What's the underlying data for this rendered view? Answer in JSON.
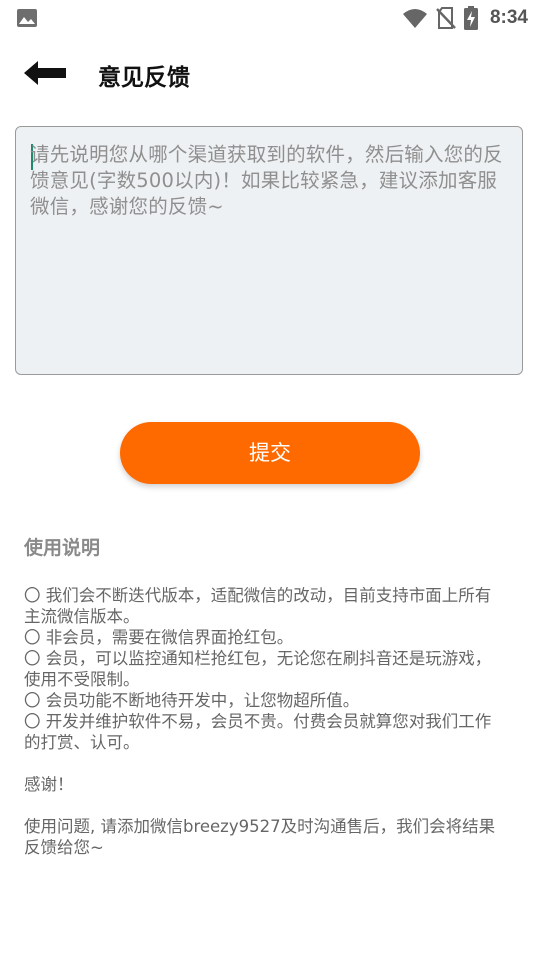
{
  "status_bar": {
    "time": "8:34",
    "icons": [
      "image-icon",
      "wifi-icon",
      "no-sim-icon",
      "battery-charging-icon"
    ]
  },
  "header": {
    "back_icon": "back-arrow-icon",
    "title": "意见反馈"
  },
  "feedback": {
    "placeholder": "请先说明您从哪个渠道获取到的软件，然后输入您的反馈意见(字数500以内)！如果比较紧急，建议添加客服微信，感谢您的反馈~",
    "value": ""
  },
  "submit_label": "提交",
  "instructions": {
    "title": "使用说明",
    "items": [
      "〇 我们会不断迭代版本，适配微信的改动，目前支持市面上所有主流微信版本。",
      " 〇 非会员，需要在微信界面抢红包。",
      " 〇 会员，可以监控通知栏抢红包，无论您在刷抖音还是玩游戏，使用不受限制。",
      " 〇 会员功能不断地待开发中，让您物超所值。",
      " 〇 开发并维护软件不易，会员不贵。付费会员就算您对我们工作的打赏、认可。"
    ],
    "thanks": " 感谢！",
    "contact": " 使用问题, 请添加微信breezy9527及时沟通售后，我们会将结果反馈给您~"
  },
  "colors": {
    "accent": "#ff6a00",
    "textarea_bg": "#eef1f3",
    "cursor": "#1e8b6e"
  }
}
